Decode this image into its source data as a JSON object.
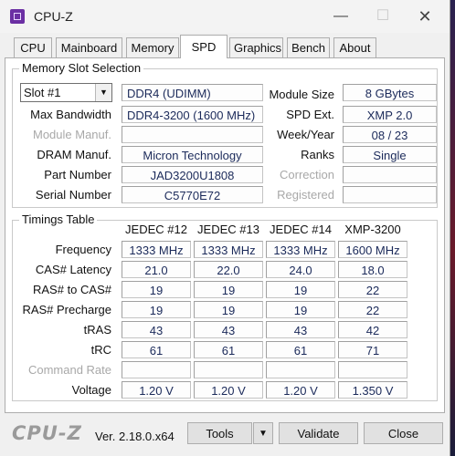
{
  "window": {
    "title": "CPU-Z",
    "minimize": "—",
    "maximize": "☐",
    "close": "✕"
  },
  "tabs": [
    "CPU",
    "Mainboard",
    "Memory",
    "SPD",
    "Graphics",
    "Bench",
    "About"
  ],
  "active_tab": "SPD",
  "slot_group": {
    "title": "Memory Slot Selection",
    "slot_selected": "Slot #1",
    "memory_type": "DDR4 (UDIMM)",
    "max_bandwidth_label": "Max Bandwidth",
    "max_bandwidth": "DDR4-3200 (1600 MHz)",
    "module_manuf_label": "Module Manuf.",
    "module_manuf": "",
    "dram_manuf_label": "DRAM Manuf.",
    "dram_manuf": "Micron Technology",
    "part_number_label": "Part Number",
    "part_number": "JAD3200U1808",
    "serial_number_label": "Serial Number",
    "serial_number": "C5770E72",
    "module_size_label": "Module Size",
    "module_size": "8 GBytes",
    "spd_ext_label": "SPD Ext.",
    "spd_ext": "XMP 2.0",
    "week_year_label": "Week/Year",
    "week_year": "08 / 23",
    "ranks_label": "Ranks",
    "ranks": "Single",
    "correction_label": "Correction",
    "correction": "",
    "registered_label": "Registered",
    "registered": ""
  },
  "timings": {
    "title": "Timings Table",
    "columns": [
      "JEDEC #12",
      "JEDEC #13",
      "JEDEC #14",
      "XMP-3200"
    ],
    "rows": [
      {
        "label": "Frequency",
        "values": [
          "1333 MHz",
          "1333 MHz",
          "1333 MHz",
          "1600 MHz"
        ]
      },
      {
        "label": "CAS# Latency",
        "values": [
          "21.0",
          "22.0",
          "24.0",
          "18.0"
        ]
      },
      {
        "label": "RAS# to CAS#",
        "values": [
          "19",
          "19",
          "19",
          "22"
        ]
      },
      {
        "label": "RAS# Precharge",
        "values": [
          "19",
          "19",
          "19",
          "22"
        ]
      },
      {
        "label": "tRAS",
        "values": [
          "43",
          "43",
          "43",
          "42"
        ]
      },
      {
        "label": "tRC",
        "values": [
          "61",
          "61",
          "61",
          "71"
        ]
      },
      {
        "label": "Command Rate",
        "values": [
          "",
          "",
          "",
          ""
        ]
      },
      {
        "label": "Voltage",
        "values": [
          "1.20 V",
          "1.20 V",
          "1.20 V",
          "1.350 V"
        ]
      }
    ]
  },
  "footer": {
    "logo": "CPU-Z",
    "version": "Ver. 2.18.0.x64",
    "tools_label": "Tools",
    "tools_arrow": "▼",
    "validate_label": "Validate",
    "close_label": "Close"
  }
}
